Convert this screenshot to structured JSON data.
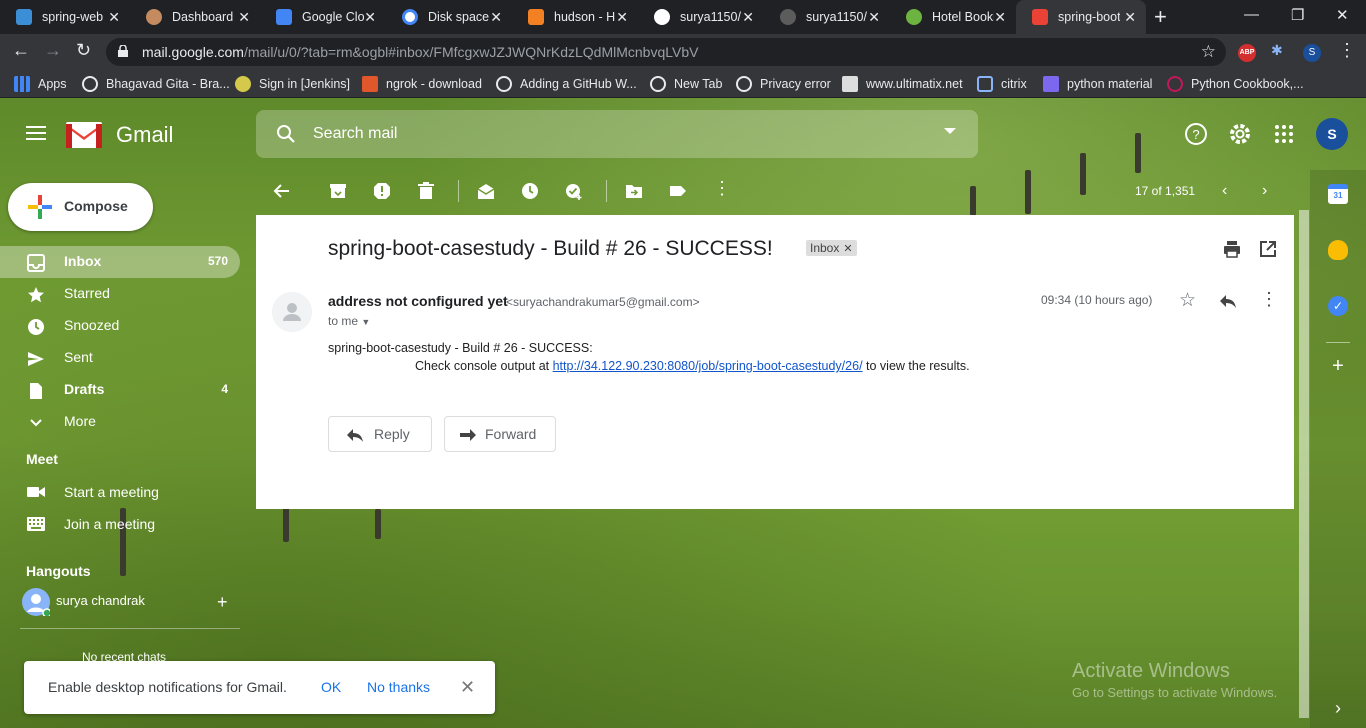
{
  "browser": {
    "tabs": [
      {
        "title": "spring-web",
        "color": "#3c8fd6"
      },
      {
        "title": "Dashboard",
        "color": "#c38b5f"
      },
      {
        "title": "Google Clo",
        "color": "#4285f4"
      },
      {
        "title": "Disk space",
        "color": "#ffffff"
      },
      {
        "title": "hudson - H",
        "color": "#f48024"
      },
      {
        "title": "surya1150/",
        "color": "#ffffff"
      },
      {
        "title": "surya1150/",
        "color": "#5c5c5c"
      },
      {
        "title": "Hotel Booki",
        "color": "#6db33f"
      },
      {
        "title": "spring-boot",
        "color": "#ea4335"
      }
    ],
    "url_host": "mail.google.com",
    "url_path": "/mail/u/0/?tab=rm&ogbl#inbox/FMfcgxwJZJWQNrKdzLQdMlMcnbvqLVbV",
    "bookmarks": [
      {
        "label": "Apps",
        "color": "#4285f4"
      },
      {
        "label": "Bhagavad Gita - Bra...",
        "color": "#ffffff"
      },
      {
        "label": "Sign in [Jenkins]",
        "color": "#d4c94a"
      },
      {
        "label": "ngrok - download",
        "color": "#e0572b"
      },
      {
        "label": "Adding a GitHub W...",
        "color": "#ffffff"
      },
      {
        "label": "New Tab",
        "color": "#ffffff"
      },
      {
        "label": "Privacy error",
        "color": "#ffffff"
      },
      {
        "label": "www.ultimatix.net",
        "color": "#dddddd"
      },
      {
        "label": "citrix",
        "color": "#8ab4f8"
      },
      {
        "label": "python material",
        "color": "#7b68ee"
      },
      {
        "label": "Python Cookbook,...",
        "color": "#c2185b"
      }
    ],
    "ext_abp": "ABP",
    "profile_initial": "S"
  },
  "gmail": {
    "app_name": "Gmail",
    "search_placeholder": "Search mail",
    "compose_label": "Compose",
    "nav": [
      {
        "label": "Inbox",
        "count": "570",
        "icon": "inbox-icon"
      },
      {
        "label": "Starred",
        "count": "",
        "icon": "star-icon"
      },
      {
        "label": "Snoozed",
        "count": "",
        "icon": "clock-icon"
      },
      {
        "label": "Sent",
        "count": "",
        "icon": "send-icon"
      },
      {
        "label": "Drafts",
        "count": "4",
        "icon": "draft-icon"
      },
      {
        "label": "More",
        "count": "",
        "icon": "chevron-down-icon"
      }
    ],
    "meet_title": "Meet",
    "meet_items": [
      "Start a meeting",
      "Join a meeting"
    ],
    "hangouts_title": "Hangouts",
    "hangouts_user": "surya chandrak",
    "no_recent": "No recent chats",
    "pager": "17 of 1,351",
    "avatar_initial": "S"
  },
  "message": {
    "subject": "spring-boot-casestudy - Build # 26 - SUCCESS!",
    "label_chip": "Inbox",
    "sender_name": "address not configured yet",
    "sender_email": "<suryachandrakumar5@gmail.com>",
    "to": "to me",
    "time": "09:34 (10 hours ago)",
    "body_line1": "spring-boot-casestudy - Build # 26 - SUCCESS:",
    "body_prefix": "Check console output at ",
    "body_link": "http://34.122.90.230:8080/job/spring-boot-casestudy/26/",
    "body_suffix": " to view the results.",
    "reply_label": "Reply",
    "forward_label": "Forward"
  },
  "notification": {
    "text": "Enable desktop notifications for Gmail.",
    "ok": "OK",
    "no_thanks": "No thanks"
  },
  "watermark": {
    "line1": "Activate Windows",
    "line2": "Go to Settings to activate Windows."
  }
}
